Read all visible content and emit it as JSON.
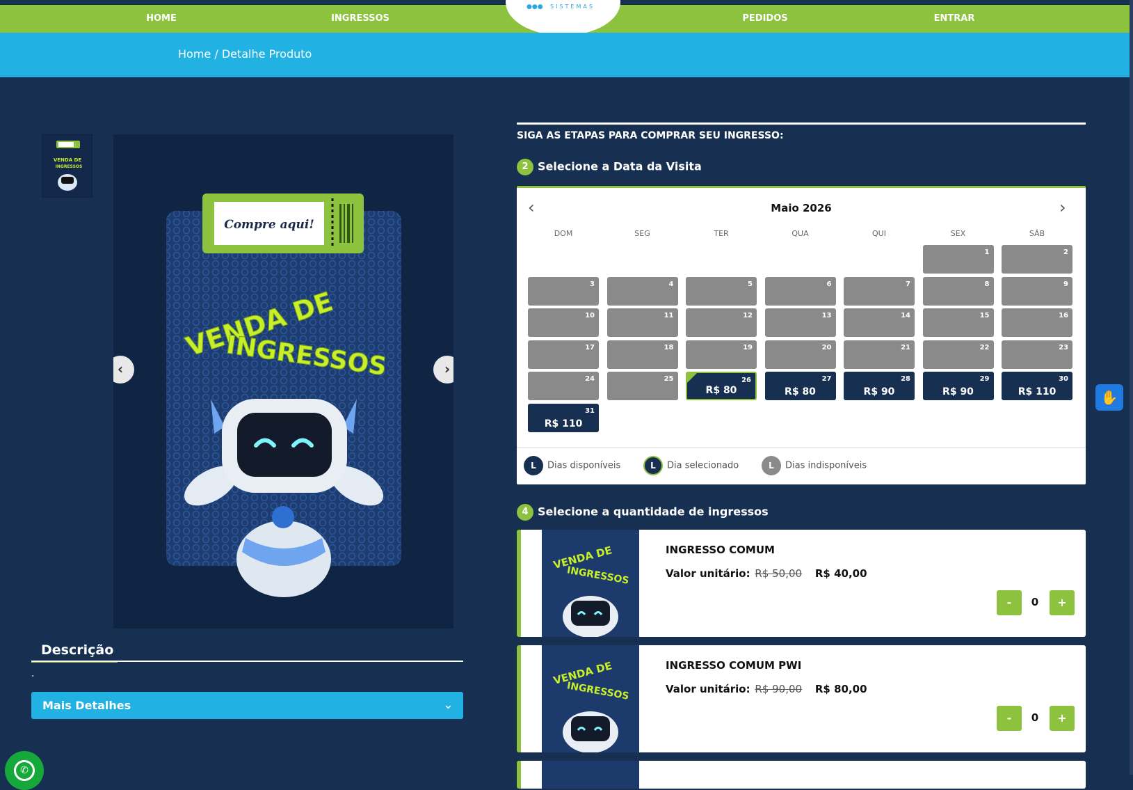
{
  "nav": {
    "home": "HOME",
    "ingressos": "INGRESSOS",
    "pedidos": "PEDIDOS",
    "entrar": "ENTRAR",
    "logo_text": "SISTEMAS"
  },
  "breadcrumb": {
    "home": "Home",
    "separator": " / ",
    "current": "Detalhe Produto"
  },
  "gallery": {
    "banner_ticket": "Compre aqui!",
    "banner_title_1": "VENDA DE",
    "banner_title_2": "INGRESSOS",
    "prev_icon": "chevron-left-icon",
    "next_icon": "chevron-right-icon"
  },
  "description": {
    "title": "Descrição",
    "body": ".",
    "more_details": "Mais Detalhes"
  },
  "steps": {
    "heading": "SIGA AS ETAPAS PARA COMPRAR SEU INGRESSO:",
    "step2_num": "2",
    "step2_title": "Selecione a Data da Visita",
    "step4_num": "4",
    "step4_title": "Selecione a quantidade de ingressos"
  },
  "calendar": {
    "month": "Maio 2026",
    "weekdays": [
      "DOM",
      "SEG",
      "TER",
      "QUA",
      "QUI",
      "SEX",
      "SÁB"
    ],
    "days": [
      {
        "d": "1",
        "status": "unavailable",
        "price": ""
      },
      {
        "d": "2",
        "status": "unavailable",
        "price": ""
      },
      {
        "d": "3",
        "status": "unavailable",
        "price": ""
      },
      {
        "d": "4",
        "status": "unavailable",
        "price": ""
      },
      {
        "d": "5",
        "status": "unavailable",
        "price": ""
      },
      {
        "d": "6",
        "status": "unavailable",
        "price": ""
      },
      {
        "d": "7",
        "status": "unavailable",
        "price": ""
      },
      {
        "d": "8",
        "status": "unavailable",
        "price": ""
      },
      {
        "d": "9",
        "status": "unavailable",
        "price": ""
      },
      {
        "d": "10",
        "status": "unavailable",
        "price": ""
      },
      {
        "d": "11",
        "status": "unavailable",
        "price": ""
      },
      {
        "d": "12",
        "status": "unavailable",
        "price": ""
      },
      {
        "d": "13",
        "status": "unavailable",
        "price": ""
      },
      {
        "d": "14",
        "status": "unavailable",
        "price": ""
      },
      {
        "d": "15",
        "status": "unavailable",
        "price": ""
      },
      {
        "d": "16",
        "status": "unavailable",
        "price": ""
      },
      {
        "d": "17",
        "status": "unavailable",
        "price": ""
      },
      {
        "d": "18",
        "status": "unavailable",
        "price": ""
      },
      {
        "d": "19",
        "status": "unavailable",
        "price": ""
      },
      {
        "d": "20",
        "status": "unavailable",
        "price": ""
      },
      {
        "d": "21",
        "status": "unavailable",
        "price": ""
      },
      {
        "d": "22",
        "status": "unavailable",
        "price": ""
      },
      {
        "d": "23",
        "status": "unavailable",
        "price": ""
      },
      {
        "d": "24",
        "status": "unavailable",
        "price": ""
      },
      {
        "d": "25",
        "status": "unavailable",
        "price": ""
      },
      {
        "d": "26",
        "status": "selected",
        "price": "R$ 80"
      },
      {
        "d": "27",
        "status": "available",
        "price": "R$ 80"
      },
      {
        "d": "28",
        "status": "available",
        "price": "R$ 90"
      },
      {
        "d": "29",
        "status": "available",
        "price": "R$ 90"
      },
      {
        "d": "30",
        "status": "available",
        "price": "R$ 110"
      },
      {
        "d": "31",
        "status": "available",
        "price": "R$ 110"
      }
    ],
    "legend": {
      "available": "Dias disponíveis",
      "selected": "Dia selecionado",
      "unavailable": "Dias indisponíveis",
      "badge": "L"
    }
  },
  "tickets": [
    {
      "name": "INGRESSO COMUM",
      "unit_label": "Valor unitário:",
      "old_price": "R$ 50,00",
      "new_price": "R$ 40,00",
      "qty": "0",
      "minus": "-",
      "plus": "+"
    },
    {
      "name": "INGRESSO COMUM PWI",
      "unit_label": "Valor unitário:",
      "old_price": "R$ 90,00",
      "new_price": "R$ 80,00",
      "qty": "0",
      "minus": "-",
      "plus": "+"
    }
  ],
  "colors": {
    "brand_green": "#8dc23f",
    "brand_blue": "#21b1e3",
    "navy": "#172f51",
    "unavailable_gray": "#8a8a8a"
  }
}
